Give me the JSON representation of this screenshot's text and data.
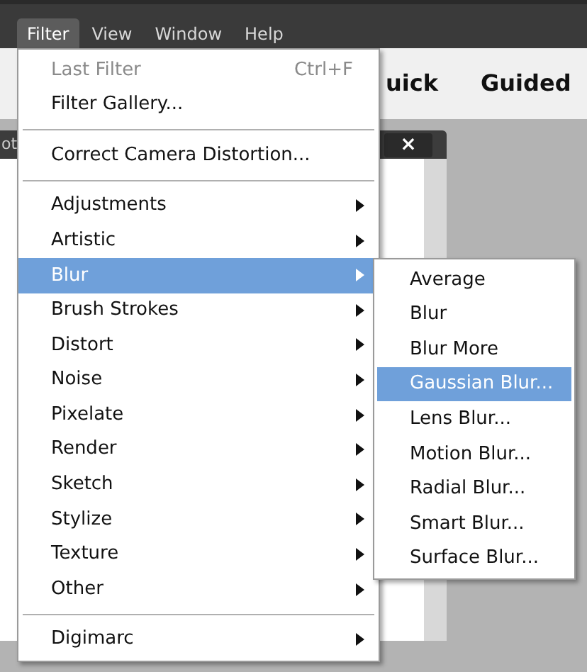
{
  "menubar": {
    "items": [
      {
        "label": "Filter",
        "selected": true
      },
      {
        "label": "View",
        "selected": false
      },
      {
        "label": "Window",
        "selected": false
      },
      {
        "label": "Help",
        "selected": false
      }
    ]
  },
  "mode_tabs": [
    "uick",
    "Guided"
  ],
  "document": {
    "title": "ot",
    "close": "×"
  },
  "menu": {
    "items": [
      {
        "kind": "item",
        "label": "Last Filter",
        "shortcut": "Ctrl+F",
        "disabled": true,
        "submenu": false,
        "selected": false
      },
      {
        "kind": "item",
        "label": "Filter Gallery...",
        "disabled": false,
        "submenu": false,
        "selected": false
      },
      {
        "kind": "separator"
      },
      {
        "kind": "item",
        "label": "Correct Camera Distortion...",
        "disabled": false,
        "submenu": false,
        "selected": false
      },
      {
        "kind": "separator"
      },
      {
        "kind": "item",
        "label": "Adjustments",
        "disabled": false,
        "submenu": true,
        "selected": false
      },
      {
        "kind": "item",
        "label": "Artistic",
        "disabled": false,
        "submenu": true,
        "selected": false
      },
      {
        "kind": "item",
        "label": "Blur",
        "disabled": false,
        "submenu": true,
        "selected": true
      },
      {
        "kind": "item",
        "label": "Brush Strokes",
        "disabled": false,
        "submenu": true,
        "selected": false
      },
      {
        "kind": "item",
        "label": "Distort",
        "disabled": false,
        "submenu": true,
        "selected": false
      },
      {
        "kind": "item",
        "label": "Noise",
        "disabled": false,
        "submenu": true,
        "selected": false
      },
      {
        "kind": "item",
        "label": "Pixelate",
        "disabled": false,
        "submenu": true,
        "selected": false
      },
      {
        "kind": "item",
        "label": "Render",
        "disabled": false,
        "submenu": true,
        "selected": false
      },
      {
        "kind": "item",
        "label": "Sketch",
        "disabled": false,
        "submenu": true,
        "selected": false
      },
      {
        "kind": "item",
        "label": "Stylize",
        "disabled": false,
        "submenu": true,
        "selected": false
      },
      {
        "kind": "item",
        "label": "Texture",
        "disabled": false,
        "submenu": true,
        "selected": false
      },
      {
        "kind": "item",
        "label": "Other",
        "disabled": false,
        "submenu": true,
        "selected": false
      },
      {
        "kind": "separator"
      },
      {
        "kind": "item",
        "label": "Digimarc",
        "disabled": false,
        "submenu": true,
        "selected": false
      }
    ]
  },
  "submenu": {
    "items": [
      {
        "label": "Average",
        "selected": false
      },
      {
        "label": "Blur",
        "selected": false
      },
      {
        "label": "Blur More",
        "selected": false
      },
      {
        "label": "Gaussian Blur...",
        "selected": true
      },
      {
        "label": "Lens Blur...",
        "selected": false
      },
      {
        "label": "Motion Blur...",
        "selected": false
      },
      {
        "label": "Radial Blur...",
        "selected": false
      },
      {
        "label": "Smart Blur...",
        "selected": false
      },
      {
        "label": "Surface Blur...",
        "selected": false
      }
    ]
  }
}
